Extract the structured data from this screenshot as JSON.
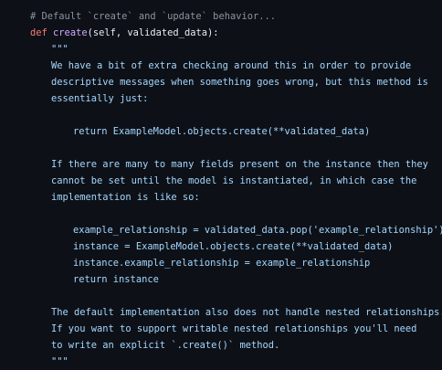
{
  "code": {
    "comment": "# Default `create` and `update` behavior...",
    "def_keyword": "def",
    "func_name": "create",
    "signature": "(self, validated_data):",
    "doc_open": "\"\"\"",
    "lines": [
      "We have a bit of extra checking around this in order to provide",
      "descriptive messages when something goes wrong, but this method is",
      "essentially just:",
      "return ExampleModel.objects.create(**validated_data)",
      "If there are many to many fields present on the instance then they",
      "cannot be set until the model is instantiated, in which case the",
      "implementation is like so:",
      "example_relationship = validated_data.pop('example_relationship')",
      "instance = ExampleModel.objects.create(**validated_data)",
      "instance.example_relationship = example_relationship",
      "return instance",
      "The default implementation also does not handle nested relationships.",
      "If you want to support writable nested relationships you'll need",
      "to write an explicit `.create()` method."
    ],
    "doc_close": "\"\"\""
  }
}
